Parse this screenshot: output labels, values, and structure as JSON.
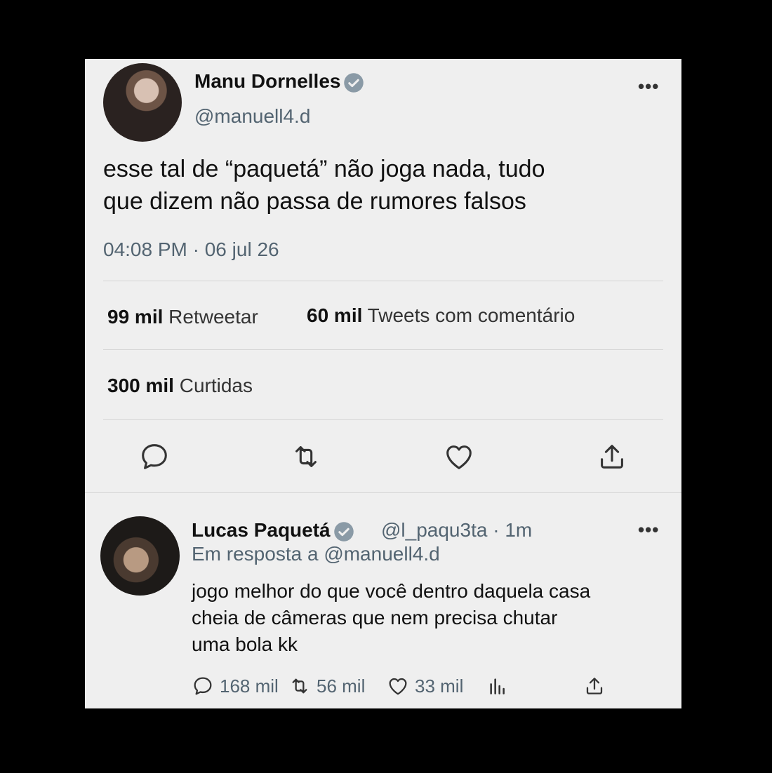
{
  "tweet": {
    "author_name": "Manu Dornelles",
    "author_handle": "@manuell4.d",
    "more": "•••",
    "text_line1": "esse tal de “paquetá” não joga nada, tudo",
    "text_line2": "que dizem não passa de rumores falsos",
    "timestamp": "04:08 PM · 06 jul 26",
    "retweets_count": "99 mil",
    "retweets_label": "Retweetar",
    "quotes_count": "60 mil",
    "quotes_label": "Tweets com comentário",
    "likes_count": "300 mil",
    "likes_label": "Curtidas",
    "icons": [
      "reply-icon",
      "retweet-icon",
      "like-icon",
      "share-icon"
    ]
  },
  "reply": {
    "author_name": "Lucas Paquetá",
    "handle_time": "@l_paqu3ta · 1m",
    "more": "•••",
    "in_reply_prefix": "Em resposta a ",
    "in_reply_handle": "@manuell4.d",
    "text_line1": "jogo melhor do que você dentro daquela casa",
    "text_line2": "cheia de câmeras que nem precisa chutar",
    "text_line3": "uma bola kk",
    "reply_count": "168 mil",
    "retweet_count": "56 mil",
    "like_count": "33 mil",
    "icons": [
      "reply-icon",
      "retweet-icon",
      "like-icon",
      "analytics-icon",
      "share-icon"
    ]
  },
  "colors": {
    "background": "#000000",
    "card": "#efefef",
    "verified": "#8a9aa6",
    "link": "#536471"
  }
}
